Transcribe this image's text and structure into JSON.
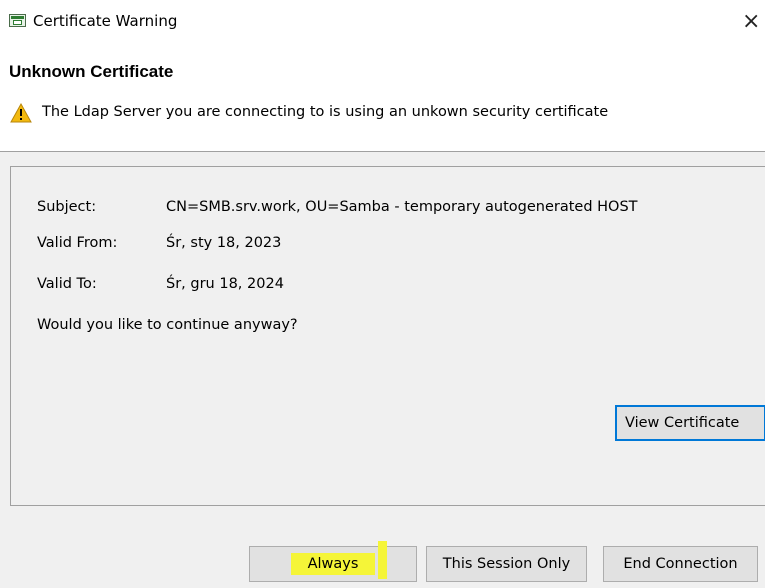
{
  "window": {
    "title": "Certificate Warning",
    "close_glyph": "×"
  },
  "header": {
    "heading": "Unknown Certificate",
    "message": "The Ldap Server you are connecting to is using an unkown security certificate",
    "icon": "warning-icon"
  },
  "details": {
    "subject_label": "Subject:",
    "subject_value": "CN=SMB.srv.work, OU=Samba - temporary autogenerated HOST",
    "valid_from_label": "Valid From:",
    "valid_from_value": "Śr, sty 18, 2023",
    "valid_to_label": "Valid To:",
    "valid_to_value": "Śr, gru 18, 2024",
    "question": "Would you like to continue anyway?",
    "view_certificate_label": "View Certificate"
  },
  "buttons": {
    "always_label": "Always",
    "session_label": "This Session Only",
    "end_label": "End Connection"
  },
  "colors": {
    "highlight": "#f5f538",
    "focus_border": "#0078d7",
    "warning": "#f2b90f"
  }
}
